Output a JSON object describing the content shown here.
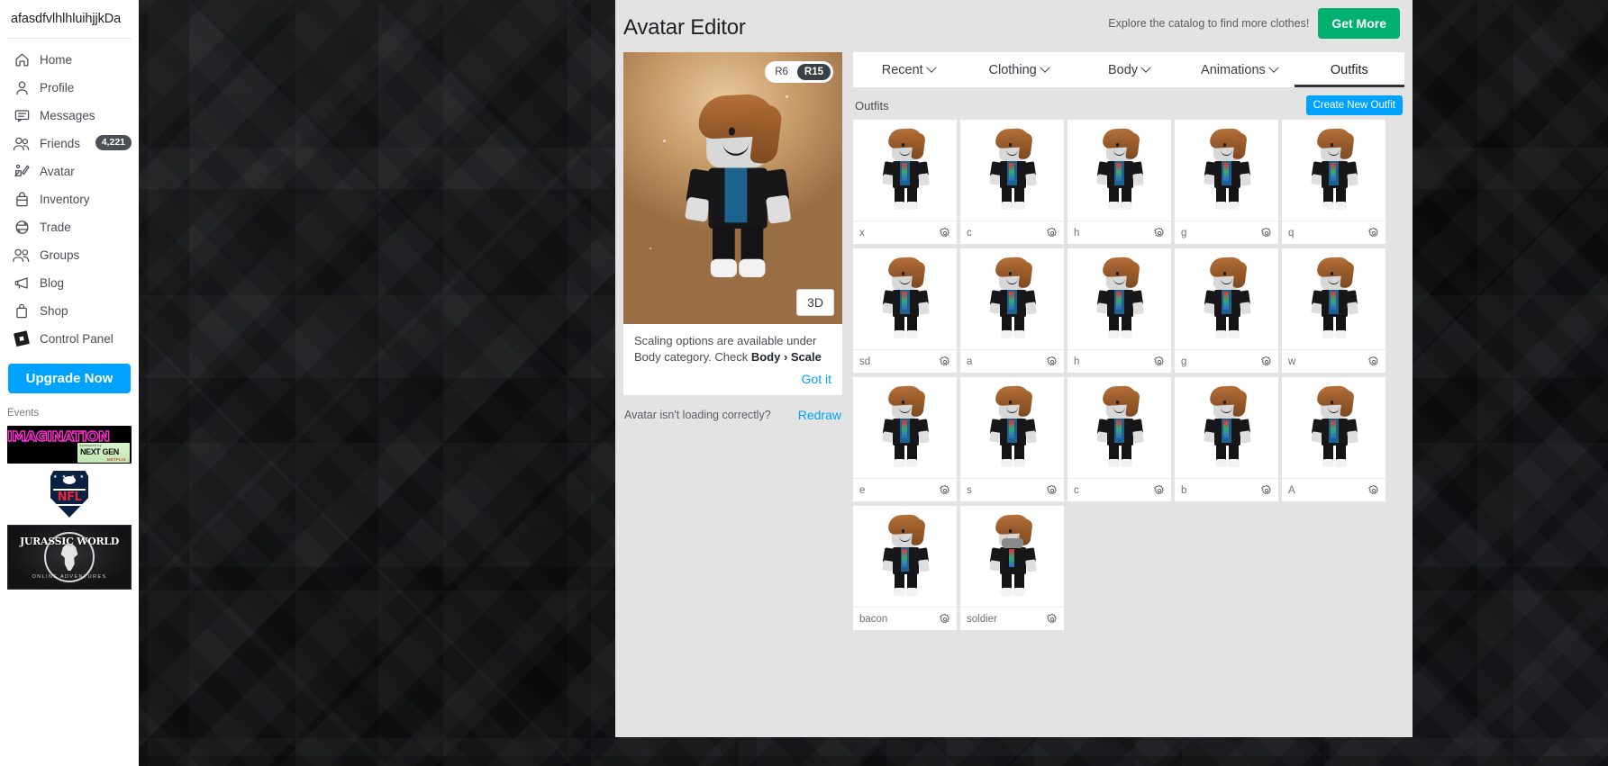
{
  "sidebar": {
    "username": "afasdfvlhlhluihjjkDa",
    "items": [
      {
        "label": "Home",
        "icon": "home-icon"
      },
      {
        "label": "Profile",
        "icon": "person-icon"
      },
      {
        "label": "Messages",
        "icon": "message-icon"
      },
      {
        "label": "Friends",
        "icon": "friends-icon",
        "badge": "4,221"
      },
      {
        "label": "Avatar",
        "icon": "avatar-icon"
      },
      {
        "label": "Inventory",
        "icon": "bag-icon"
      },
      {
        "label": "Trade",
        "icon": "trade-icon"
      },
      {
        "label": "Groups",
        "icon": "groups-icon"
      },
      {
        "label": "Blog",
        "icon": "megaphone-icon"
      },
      {
        "label": "Shop",
        "icon": "shopping-bag-icon"
      },
      {
        "label": "Control Panel",
        "icon": "roblox-logo-icon"
      }
    ],
    "upgrade_label": "Upgrade Now",
    "events_label": "Events",
    "events": [
      {
        "name": "imagination-banner",
        "word": "IMAGINATION",
        "sponsor_small": "Sponsored by",
        "sponsor_main": "NEXT GEN",
        "sponsor_net": "NETFLIX"
      },
      {
        "name": "nfl-banner",
        "top": "★ ★ ★ ★",
        "word": "NFL"
      },
      {
        "name": "jurassic-world-banner",
        "word": "JURASSIC WORLD",
        "sub": "ONLINE ADVENTURES"
      }
    ]
  },
  "editor": {
    "title": "Avatar Editor",
    "catalog_text": "Explore the catalog to find more clothes!",
    "get_more_label": "Get More",
    "rig": {
      "options": [
        "R6",
        "R15"
      ],
      "selected": "R15"
    },
    "view_button": "3D",
    "scale_tip": {
      "line1": "Scaling options are available under",
      "line2_prefix": "Body category. Check ",
      "line2_bold": "Body › Scale",
      "dismiss": "Got it"
    },
    "redraw": {
      "question": "Avatar isn't loading correctly?",
      "action": "Redraw"
    },
    "tabs": [
      {
        "label": "Recent",
        "has_chevron": true,
        "active": false
      },
      {
        "label": "Clothing",
        "has_chevron": true,
        "active": false
      },
      {
        "label": "Body",
        "has_chevron": true,
        "active": false
      },
      {
        "label": "Animations",
        "has_chevron": true,
        "active": false
      },
      {
        "label": "Outfits",
        "has_chevron": false,
        "active": true
      }
    ],
    "grid_header": {
      "label": "Outfits",
      "create_label": "Create New Outfit"
    },
    "outfits": [
      {
        "name": "x",
        "style": "default"
      },
      {
        "name": "c",
        "style": "default"
      },
      {
        "name": "h",
        "style": "default"
      },
      {
        "name": "g",
        "style": "default"
      },
      {
        "name": "q",
        "style": "default"
      },
      {
        "name": "sd",
        "style": "default"
      },
      {
        "name": "a",
        "style": "default"
      },
      {
        "name": "h",
        "style": "default"
      },
      {
        "name": "g",
        "style": "default"
      },
      {
        "name": "w",
        "style": "default"
      },
      {
        "name": "e",
        "style": "default"
      },
      {
        "name": "s",
        "style": "default"
      },
      {
        "name": "c",
        "style": "default"
      },
      {
        "name": "b",
        "style": "default"
      },
      {
        "name": "A",
        "style": "default"
      },
      {
        "name": "bacon",
        "style": "bacon"
      },
      {
        "name": "soldier",
        "style": "soldier"
      }
    ]
  },
  "colors": {
    "accent_blue": "#00a2ff",
    "accent_green": "#00b06f",
    "panel_bg": "#e3e3e3",
    "tab_underline": "#2f3236",
    "badge_bg": "#4c4f53"
  }
}
